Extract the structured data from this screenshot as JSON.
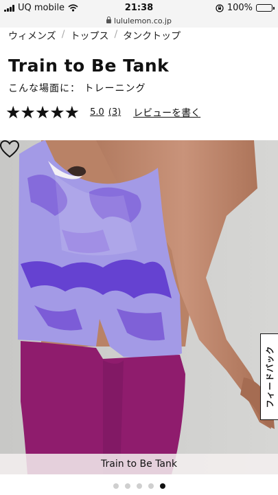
{
  "status_bar": {
    "carrier": "UQ mobile",
    "time": "21:38",
    "battery": "100%"
  },
  "url_bar": {
    "domain": "lululemon.co.jp"
  },
  "breadcrumb": [
    "ウィメンズ",
    "トップス",
    "タンクトップ"
  ],
  "product": {
    "title": "Train to Be Tank",
    "activity": "こんな場面に： トレーニング",
    "stars": "★★★★★",
    "rating": "5.0",
    "review_count": "(3)",
    "write_review": "レビューを書く"
  },
  "gallery": {
    "caption": "Train to Be Tank",
    "current_slide": 5,
    "total_slides": 5,
    "feedback_label": "フィードバック"
  },
  "colors": {
    "tank_purple": "#a39ae6",
    "dye_purple": "#6b42d0",
    "leggings": "#8f1c6d",
    "skin": "#c08a6e"
  },
  "icons": {
    "favorite": "heart-icon",
    "wifi": "wifi-icon",
    "lock": "lock-icon",
    "orientation": "orientation-lock-icon"
  }
}
